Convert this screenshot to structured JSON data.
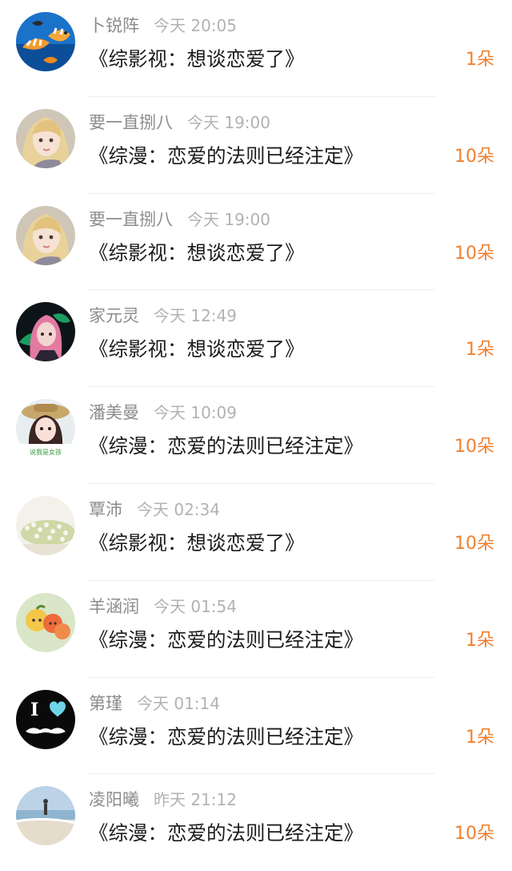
{
  "items": [
    {
      "name": "卜锐阵",
      "time": "今天 20:05",
      "title": "《综影视：想谈恋爱了》",
      "count": "1朵",
      "avatar": "fish-avatar"
    },
    {
      "name": "要一直捌八",
      "time": "今天 19:00",
      "title": "《综漫：恋爱的法则已经注定》",
      "count": "10朵",
      "avatar": "blonde-girl-avatar"
    },
    {
      "name": "要一直捌八",
      "time": "今天 19:00",
      "title": "《综影视：想谈恋爱了》",
      "count": "10朵",
      "avatar": "blonde-girl-avatar"
    },
    {
      "name": "家元灵",
      "time": "今天 12:49",
      "title": "《综影视：想谈恋爱了》",
      "count": "1朵",
      "avatar": "pink-hair-avatar"
    },
    {
      "name": "潘美曼",
      "time": "今天 10:09",
      "title": "《综漫：恋爱的法则已经注定》",
      "count": "10朵",
      "avatar": "girl-hat-avatar"
    },
    {
      "name": "覃沛",
      "time": "今天 02:34",
      "title": "《综影视：想谈恋爱了》",
      "count": "10朵",
      "avatar": "flowers-avatar"
    },
    {
      "name": "羊涵润",
      "time": "今天 01:54",
      "title": "《综漫：恋爱的法则已经注定》",
      "count": "1朵",
      "avatar": "fruit-avatar"
    },
    {
      "name": "第瑾",
      "time": "今天 01:14",
      "title": "《综漫：恋爱的法则已经注定》",
      "count": "1朵",
      "avatar": "i-love-mustache-avatar"
    },
    {
      "name": "凌阳曦",
      "time": "昨天 21:12",
      "title": "《综漫：恋爱的法则已经注定》",
      "count": "10朵",
      "avatar": "beach-avatar"
    }
  ],
  "avatar_text": {
    "girl_hat_caption": "说我是女孩",
    "i_love_letter": "I"
  },
  "colors": {
    "name": "#8c8c8c",
    "time": "#b2b2b2",
    "title": "#1c1c1c",
    "count": "#f07f2e",
    "divider": "#efefef"
  }
}
